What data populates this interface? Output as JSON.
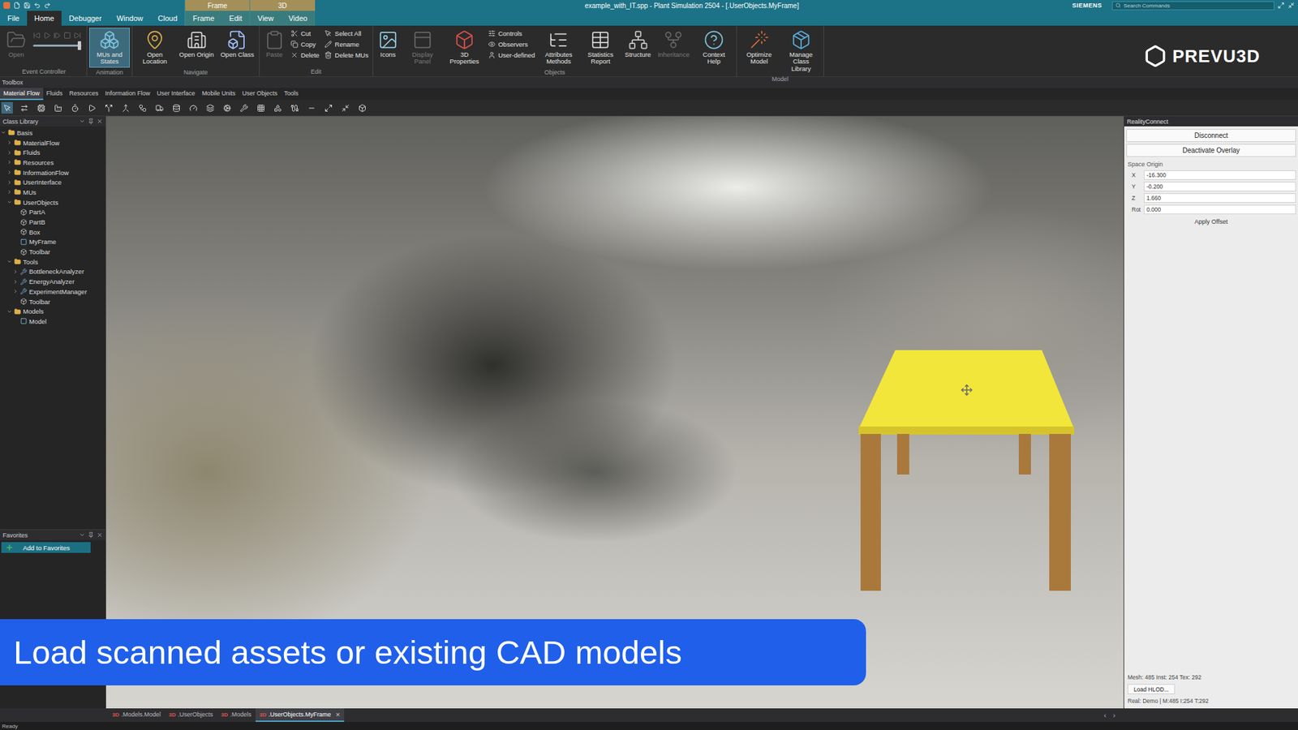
{
  "window": {
    "title": "example_with_IT.spp - Plant Simulation 2504 - [.UserObjects.MyFrame]",
    "brand": "SIEMENS",
    "search_placeholder": "Search Commands"
  },
  "menu": {
    "tabs": [
      {
        "label": "File",
        "selected": false
      },
      {
        "label": "Home",
        "selected": true
      },
      {
        "label": "Debugger",
        "selected": false
      },
      {
        "label": "Window",
        "selected": false
      },
      {
        "label": "Cloud",
        "selected": false
      }
    ],
    "context_groups": [
      {
        "label": "Frame",
        "tabs": [
          {
            "label": "Frame",
            "selected": false
          },
          {
            "label": "Edit",
            "selected": false
          }
        ]
      },
      {
        "label": "3D",
        "tabs": [
          {
            "label": "View",
            "selected": false
          },
          {
            "label": "Video",
            "selected": false
          }
        ]
      }
    ]
  },
  "logo": {
    "text": "PREVU3D"
  },
  "ribbon": {
    "groups": [
      {
        "label": "Event Controller",
        "items": [
          {
            "kind": "large",
            "label": "Open",
            "disabled": true,
            "selected": false
          },
          {
            "kind": "player",
            "level": 0.95
          }
        ]
      },
      {
        "label": "Animation",
        "items": [
          {
            "kind": "large",
            "label": "MUs and States",
            "disabled": false,
            "selected": true
          }
        ]
      },
      {
        "label": "Navigate",
        "items": [
          {
            "kind": "large",
            "label": "Open Location",
            "disabled": false,
            "selected": false
          },
          {
            "kind": "large",
            "label": "Open Origin",
            "disabled": false,
            "selected": false
          },
          {
            "kind": "large",
            "label": "Open Class",
            "disabled": false,
            "selected": false
          }
        ]
      },
      {
        "label": "Edit",
        "items": [
          {
            "kind": "large",
            "label": "Paste",
            "disabled": true,
            "selected": false
          },
          {
            "kind": "stack",
            "buttons": [
              {
                "label": "Cut",
                "disabled": false
              },
              {
                "label": "Copy",
                "disabled": false
              },
              {
                "label": "Delete",
                "disabled": false
              }
            ]
          },
          {
            "kind": "stack",
            "buttons": [
              {
                "label": "Select All",
                "disabled": false
              },
              {
                "label": "Rename",
                "disabled": false
              },
              {
                "label": "Delete MUs",
                "disabled": false
              }
            ]
          }
        ]
      },
      {
        "label": "Objects",
        "items": [
          {
            "kind": "large",
            "label": "Icons",
            "disabled": false,
            "selected": false
          },
          {
            "kind": "large",
            "label": "Display Panel",
            "disabled": true,
            "selected": false
          },
          {
            "kind": "large",
            "label": "3D Properties",
            "disabled": false,
            "selected": false
          },
          {
            "kind": "stack",
            "buttons": [
              {
                "label": "Controls",
                "disabled": false
              },
              {
                "label": "Observers",
                "disabled": false
              },
              {
                "label": "User-defined",
                "disabled": false
              }
            ]
          },
          {
            "kind": "large",
            "label": "Attributes Methods",
            "disabled": false,
            "selected": false
          },
          {
            "kind": "large",
            "label": "Statistics Report",
            "disabled": false,
            "selected": false
          },
          {
            "kind": "large",
            "label": "Structure",
            "disabled": false,
            "selected": false
          },
          {
            "kind": "large",
            "label": "Inheritance",
            "disabled": true,
            "selected": false
          },
          {
            "kind": "large",
            "label": "Context Help",
            "disabled": false,
            "selected": false
          }
        ]
      },
      {
        "label": "Model",
        "items": [
          {
            "kind": "large",
            "label": "Optimize Model",
            "disabled": false,
            "selected": false
          },
          {
            "kind": "large",
            "label": "Manage Class Library",
            "disabled": false,
            "selected": false
          }
        ]
      }
    ]
  },
  "toolbox": {
    "title": "Toolbox",
    "tabs": [
      {
        "label": "Material Flow",
        "selected": true
      },
      {
        "label": "Fluids",
        "selected": false
      },
      {
        "label": "Resources",
        "selected": false
      },
      {
        "label": "Information Flow",
        "selected": false
      },
      {
        "label": "User Interface",
        "selected": false
      },
      {
        "label": "Mobile Units",
        "selected": false
      },
      {
        "label": "User Objects",
        "selected": false
      },
      {
        "label": "Tools",
        "selected": false
      }
    ]
  },
  "class_library": {
    "title": "Class Library",
    "items": [
      {
        "label": "Basis",
        "depth": 0,
        "kind": "folder",
        "expanded": true
      },
      {
        "label": "MaterialFlow",
        "depth": 1,
        "kind": "folder",
        "expanded": false
      },
      {
        "label": "Fluids",
        "depth": 1,
        "kind": "folder",
        "expanded": false
      },
      {
        "label": "Resources",
        "depth": 1,
        "kind": "folder",
        "expanded": false
      },
      {
        "label": "InformationFlow",
        "depth": 1,
        "kind": "folder",
        "expanded": false
      },
      {
        "label": "UserInterface",
        "depth": 1,
        "kind": "folder",
        "expanded": false
      },
      {
        "label": "MUs",
        "depth": 1,
        "kind": "folder",
        "expanded": false
      },
      {
        "label": "UserObjects",
        "depth": 1,
        "kind": "folder",
        "expanded": true
      },
      {
        "label": "PartA",
        "depth": 2,
        "kind": "object",
        "expanded": false
      },
      {
        "label": "PartB",
        "depth": 2,
        "kind": "object",
        "expanded": false
      },
      {
        "label": "Box",
        "depth": 2,
        "kind": "object",
        "expanded": false
      },
      {
        "label": "MyFrame",
        "depth": 2,
        "kind": "frame",
        "expanded": false
      },
      {
        "label": "Toolbar",
        "depth": 2,
        "kind": "object",
        "expanded": false
      },
      {
        "label": "Tools",
        "depth": 1,
        "kind": "folder",
        "expanded": true
      },
      {
        "label": "BottleneckAnalyzer",
        "depth": 2,
        "kind": "tool",
        "expanded": false
      },
      {
        "label": "EnergyAnalyzer",
        "depth": 2,
        "kind": "tool",
        "expanded": false
      },
      {
        "label": "ExperimentManager",
        "depth": 2,
        "kind": "tool",
        "expanded": false
      },
      {
        "label": "Toolbar",
        "depth": 2,
        "kind": "object",
        "expanded": false
      },
      {
        "label": "Models",
        "depth": 1,
        "kind": "folder",
        "expanded": true
      },
      {
        "label": "Model",
        "depth": 2,
        "kind": "frame",
        "expanded": false
      }
    ]
  },
  "favorites": {
    "title": "Favorites",
    "button": "Add to Favorites"
  },
  "reality_connect": {
    "title": "RealityConnect",
    "buttons": [
      "Disconnect",
      "Deactivate Overlay"
    ],
    "section": "Space Origin",
    "fields": [
      {
        "label": "X",
        "value": "-16.300"
      },
      {
        "label": "Y",
        "value": "-0.200"
      },
      {
        "label": "Z",
        "value": "1.660"
      },
      {
        "label": "Rot",
        "value": "0.000"
      }
    ],
    "apply": "Apply Offset",
    "stats": "Mesh: 485 Inst: 254 Tex: 292",
    "load_button": "Load HLOD...",
    "footer": "Real: Demo | M:485 I:254 T:292"
  },
  "document_tabs": {
    "close": "×",
    "nav": [
      "‹",
      "›"
    ],
    "tabs": [
      {
        "badge": "3D",
        "label": ".Models.Model",
        "selected": false
      },
      {
        "badge": "3D",
        "label": ".UserObjects",
        "selected": false
      },
      {
        "badge": "3D",
        "label": ".Models",
        "selected": false
      },
      {
        "badge": "3D",
        "label": ".UserObjects.MyFrame",
        "selected": true
      }
    ]
  },
  "caption": "Load scanned assets or existing CAD models",
  "status_bar": {
    "text": "Ready"
  }
}
